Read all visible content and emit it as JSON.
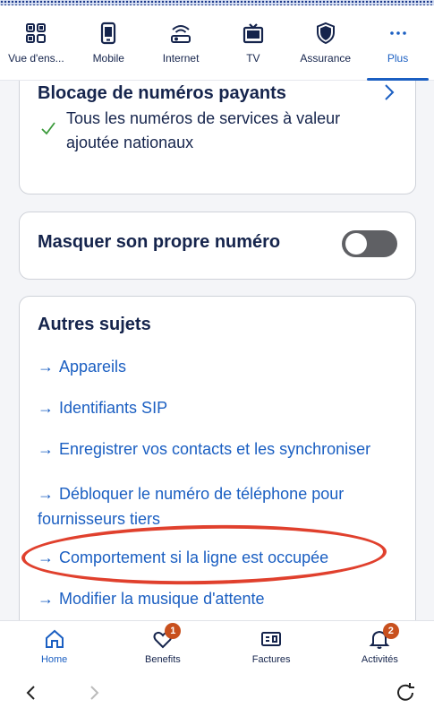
{
  "top_nav": {
    "tabs": [
      {
        "label": "Vue d'ens...",
        "icon": "grid-icon"
      },
      {
        "label": "Mobile",
        "icon": "phone-icon"
      },
      {
        "label": "Internet",
        "icon": "router-icon"
      },
      {
        "label": "TV",
        "icon": "tv-icon"
      },
      {
        "label": "Assurance",
        "icon": "shield-icon"
      },
      {
        "label": "Plus",
        "icon": "more-icon",
        "active": true
      }
    ]
  },
  "blocking_card": {
    "title": "Blocage de numéros payants",
    "item": "Tous les numéros de services à valeur ajoutée nationaux"
  },
  "hide_number_card": {
    "title": "Masquer son propre numéro",
    "toggle_on": false
  },
  "other_topics": {
    "title": "Autres sujets",
    "links": [
      "Appareils",
      "Identifiants SIP",
      "Enregistrer vos contacts et les synchroniser",
      "Débloquer le numéro de téléphone pour fournisseurs tiers",
      "Comportement si la ligne est occupée",
      "Modifier la musique d'attente"
    ],
    "arrow": "→"
  },
  "bottom_nav": {
    "tabs": [
      {
        "label": "Home",
        "icon": "home-icon",
        "active": true
      },
      {
        "label": "Benefits",
        "icon": "heart-icon",
        "badge": "1"
      },
      {
        "label": "Factures",
        "icon": "invoice-icon"
      },
      {
        "label": "Activités",
        "icon": "bell-icon",
        "badge": "2"
      }
    ]
  },
  "colors": {
    "accent": "#1b5fc2",
    "text": "#15244c",
    "badge": "#c8501e",
    "highlight": "#e0402d",
    "check": "#3a9a3a"
  }
}
